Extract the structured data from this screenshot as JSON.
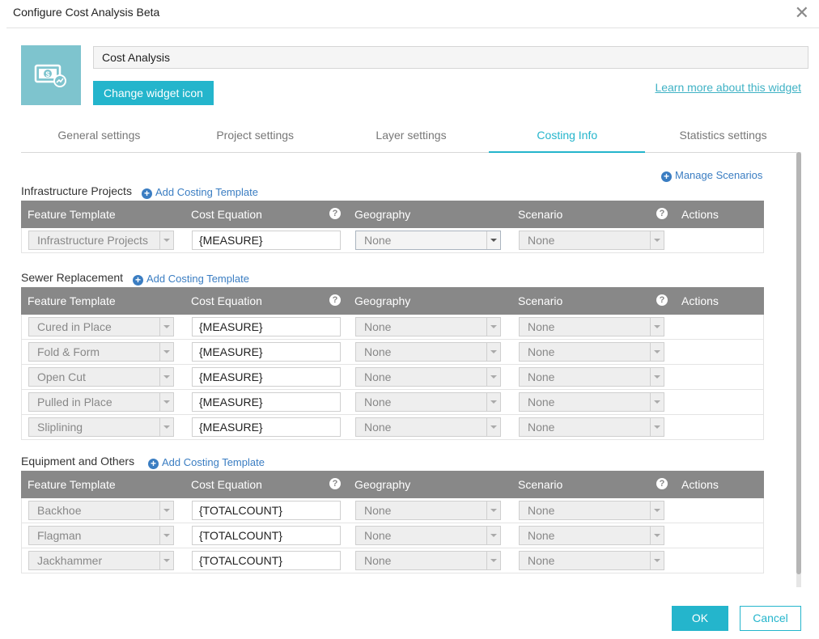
{
  "window": {
    "title": "Configure Cost Analysis Beta",
    "close_icon": "close-icon"
  },
  "widget": {
    "name": "Cost Analysis",
    "change_icon_label": "Change widget icon",
    "learn_more_label": "Learn more about this widget",
    "icon": "money-chart-icon",
    "icon_bg": "#7ec4ce"
  },
  "tabs": [
    {
      "label": "General settings",
      "active": false
    },
    {
      "label": "Project settings",
      "active": false
    },
    {
      "label": "Layer settings",
      "active": false
    },
    {
      "label": "Costing Info",
      "active": true
    },
    {
      "label": "Statistics settings",
      "active": false
    }
  ],
  "manage_scenarios_label": "Manage Scenarios",
  "columns": {
    "feature_template": "Feature Template",
    "cost_equation": "Cost Equation",
    "geography": "Geography",
    "scenario": "Scenario",
    "actions": "Actions"
  },
  "add_template_label": "Add Costing Template",
  "sections": [
    {
      "title": "Infrastructure Projects",
      "rows": [
        {
          "template": "Infrastructure Projects",
          "equation": "{MEASURE}",
          "geography": "None",
          "scenario": "None"
        }
      ]
    },
    {
      "title": "Sewer Replacement",
      "rows": [
        {
          "template": "Cured in Place",
          "equation": "{MEASURE}",
          "geography": "None",
          "scenario": "None"
        },
        {
          "template": "Fold & Form",
          "equation": "{MEASURE}",
          "geography": "None",
          "scenario": "None"
        },
        {
          "template": "Open Cut",
          "equation": "{MEASURE}",
          "geography": "None",
          "scenario": "None"
        },
        {
          "template": "Pulled in Place",
          "equation": "{MEASURE}",
          "geography": "None",
          "scenario": "None"
        },
        {
          "template": "Sliplining",
          "equation": "{MEASURE}",
          "geography": "None",
          "scenario": "None"
        }
      ]
    },
    {
      "title": "Equipment and Others",
      "rows": [
        {
          "template": "Backhoe",
          "equation": "{TOTALCOUNT}",
          "geography": "None",
          "scenario": "None"
        },
        {
          "template": "Flagman",
          "equation": "{TOTALCOUNT}",
          "geography": "None",
          "scenario": "None"
        },
        {
          "template": "Jackhammer",
          "equation": "{TOTALCOUNT}",
          "geography": "None",
          "scenario": "None"
        }
      ]
    }
  ],
  "footer": {
    "ok_label": "OK",
    "cancel_label": "Cancel"
  },
  "colors": {
    "accent": "#24b5cc",
    "link": "#3a7dc2",
    "table_header": "#888888"
  }
}
